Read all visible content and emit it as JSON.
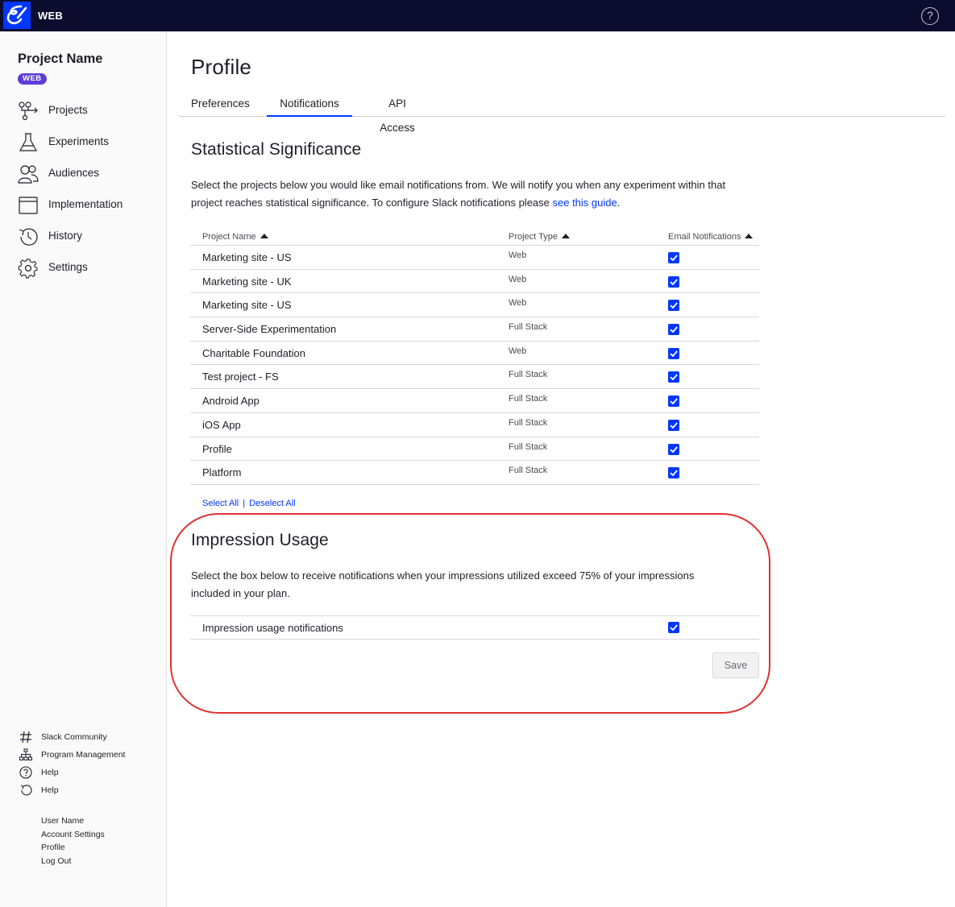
{
  "app": {
    "brand": "WEB",
    "help_icon": "question-circle-icon"
  },
  "sidebar": {
    "project_name": "Project Name",
    "project_badge": "WEB",
    "nav": [
      {
        "label": "Projects",
        "icon": "projects-icon"
      },
      {
        "label": "Experiments",
        "icon": "flask-icon"
      },
      {
        "label": "Audiences",
        "icon": "users-icon"
      },
      {
        "label": "Implementation",
        "icon": "window-icon"
      },
      {
        "label": "History",
        "icon": "history-icon"
      },
      {
        "label": "Settings",
        "icon": "gear-icon"
      }
    ],
    "footer": [
      {
        "label": "Slack Community",
        "icon": "hash-icon"
      },
      {
        "label": "Program Management",
        "icon": "hierarchy-icon"
      },
      {
        "label": "Help",
        "icon": "question-circle-icon"
      },
      {
        "label": "Help",
        "icon": "undo-icon"
      }
    ],
    "user": {
      "name": "User Name",
      "account_settings": "Account Settings",
      "profile": "Profile",
      "logout": "Log Out"
    }
  },
  "main": {
    "title": "Profile",
    "tabs": [
      {
        "label": "Preferences",
        "active": false
      },
      {
        "label": "Notifications",
        "active": true
      },
      {
        "label": "API Access",
        "active": false
      }
    ],
    "stat_sig": {
      "heading": "Statistical Significance",
      "description_line1": "Select the projects below you would like email notifications from. We will notify you when any experiment within that",
      "description_line2": "project reaches statistical significance. To configure Slack notifications please ",
      "guide_link": "see this guide",
      "description_end": ".",
      "table": {
        "headers": [
          "Project Name",
          "Project Type",
          "Email Notifications"
        ],
        "rows": [
          {
            "name": "Marketing site - US",
            "type": "Web",
            "checked": true
          },
          {
            "name": "Marketing site - UK",
            "type": "Web",
            "checked": true
          },
          {
            "name": "Marketing site - US",
            "type": "Web",
            "checked": true
          },
          {
            "name": "Server-Side Experimentation",
            "type": "Full Stack",
            "checked": true
          },
          {
            "name": "Charitable Foundation",
            "type": "Web",
            "checked": true
          },
          {
            "name": "Test project - FS",
            "type": "Full Stack",
            "checked": true
          },
          {
            "name": "Android App",
            "type": "Full Stack",
            "checked": true
          },
          {
            "name": "iOS App",
            "type": "Full Stack",
            "checked": true
          },
          {
            "name": "Profile",
            "type": "Full Stack",
            "checked": true
          },
          {
            "name": "Platform",
            "type": "Full Stack",
            "checked": true
          }
        ]
      },
      "select_all": "Select All",
      "deselect_all": "Deselect All"
    },
    "impression": {
      "heading": "Impression Usage",
      "description_line1": "Select the box below to receive notifications when your impressions utilized exceed 75% of your impressions",
      "description_line2": "included in your plan.",
      "option_label": "Impression usage notifications",
      "checked": true,
      "save_label": "Save"
    },
    "highlight_color": "#e03131",
    "accent_color": "#0037ff"
  }
}
